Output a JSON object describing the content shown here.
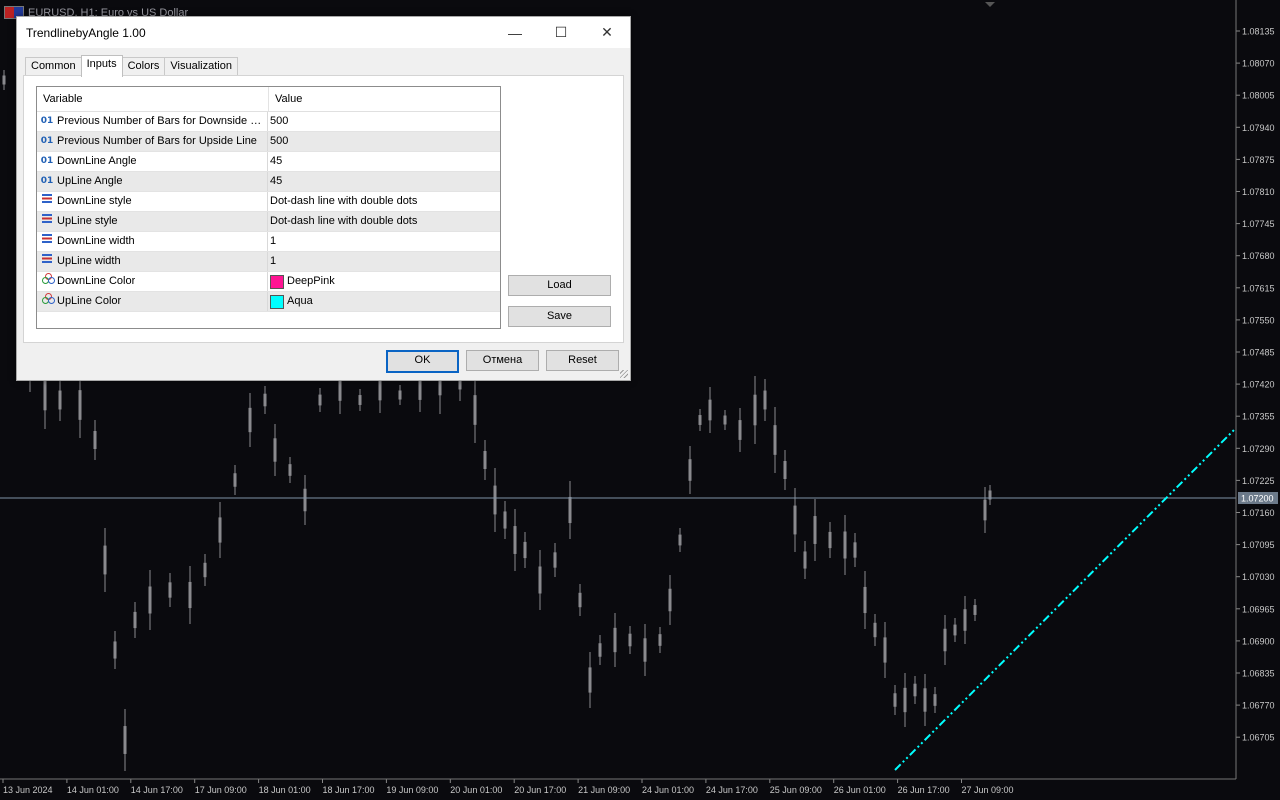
{
  "chart": {
    "symbol_title": "EURUSD, H1:  Euro vs US Dollar",
    "current_price": "1.07200",
    "price_labels": [
      "1.08135",
      "1.08070",
      "1.08005",
      "1.07940",
      "1.07875",
      "1.07810",
      "1.07745",
      "1.07680",
      "1.07615",
      "1.07550",
      "1.07485",
      "1.07420",
      "1.07355",
      "1.07290",
      "1.07225",
      "1.07160",
      "1.07095",
      "1.07030",
      "1.06965",
      "1.06900",
      "1.06835",
      "1.06770",
      "1.06705"
    ],
    "time_labels": [
      "13 Jun 2024",
      "14 Jun 01:00",
      "14 Jun 17:00",
      "17 Jun 09:00",
      "18 Jun 01:00",
      "18 Jun 17:00",
      "19 Jun 09:00",
      "20 Jun 01:00",
      "20 Jun 17:00",
      "21 Jun 09:00",
      "24 Jun 01:00",
      "24 Jun 17:00",
      "25 Jun 09:00",
      "26 Jun 01:00",
      "26 Jun 17:00",
      "27 Jun 09:00"
    ],
    "colors": {
      "background": "#0a0a0e",
      "candles": "#8a8a8e",
      "upline": "#00ffff",
      "price_line": "#7f93a6"
    }
  },
  "dialog": {
    "title": "TrendlinebyAngle 1.00",
    "tabs": [
      {
        "label": "Common"
      },
      {
        "label": "Inputs"
      },
      {
        "label": "Colors"
      },
      {
        "label": "Visualization"
      }
    ],
    "active_tab": "Inputs",
    "grid_header": {
      "variable": "Variable",
      "value": "Value"
    },
    "rows": [
      {
        "icon": "01",
        "icon_name": "integer-icon",
        "variable": "Previous Number of Bars for Downside Line",
        "value": "500"
      },
      {
        "icon": "01",
        "icon_name": "integer-icon",
        "variable": "Previous Number of Bars for Upside Line",
        "value": "500"
      },
      {
        "icon": "01",
        "icon_name": "integer-icon",
        "variable": "DownLine Angle",
        "value": "45"
      },
      {
        "icon": "01",
        "icon_name": "integer-icon",
        "variable": "UpLine Angle",
        "value": "45"
      },
      {
        "icon": "lines",
        "icon_name": "enum-icon",
        "variable": "DownLine style",
        "value": "Dot-dash line with double dots"
      },
      {
        "icon": "lines",
        "icon_name": "enum-icon",
        "variable": "UpLine style",
        "value": "Dot-dash line with double dots"
      },
      {
        "icon": "lines",
        "icon_name": "enum-icon",
        "variable": "DownLine width",
        "value": "1"
      },
      {
        "icon": "lines",
        "icon_name": "enum-icon",
        "variable": "UpLine width",
        "value": "1"
      },
      {
        "icon": "rgb",
        "icon_name": "color-icon",
        "variable": "DownLine Color",
        "value": "DeepPink",
        "swatch": "#ff1493"
      },
      {
        "icon": "rgb",
        "icon_name": "color-icon",
        "variable": "UpLine Color",
        "value": "Aqua",
        "swatch": "#00ffff"
      }
    ],
    "buttons": {
      "load": "Load",
      "save": "Save",
      "ok": "OK",
      "cancel": "Отмена",
      "reset": "Reset"
    },
    "window_controls": {
      "minimize": "—",
      "maximize": "☐",
      "close": "✕"
    }
  }
}
